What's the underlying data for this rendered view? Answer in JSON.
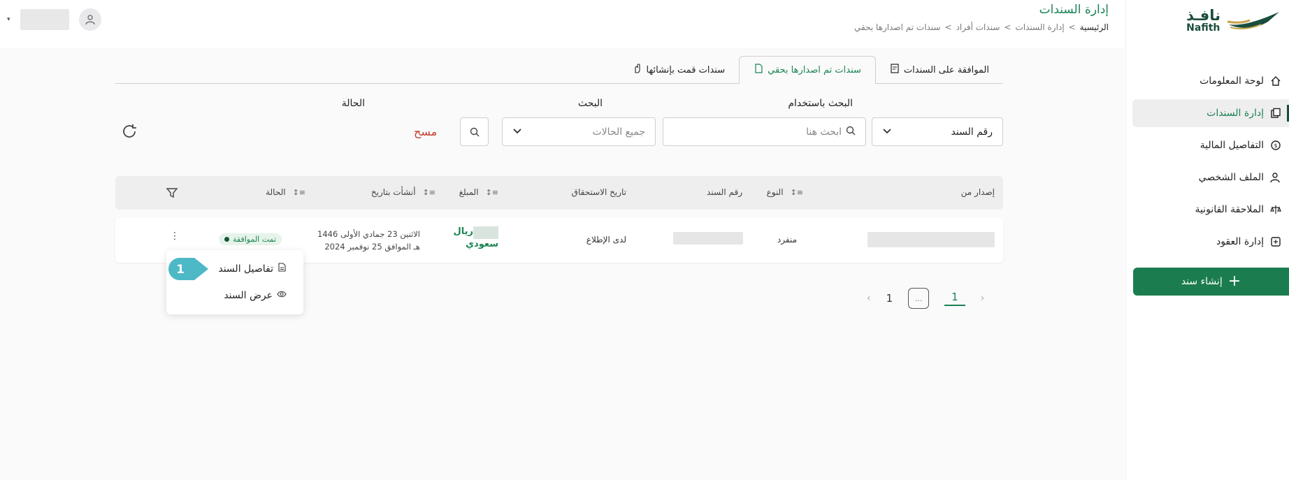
{
  "brand": {
    "name_ar": "نافـذ",
    "name_en": "Nafith"
  },
  "sidebar": {
    "items": [
      {
        "label": "لوحة المعلومات",
        "icon": "home-icon"
      },
      {
        "label": "إدارة السندات",
        "icon": "documents-icon",
        "active": true
      },
      {
        "label": "التفاصيل المالية",
        "icon": "money-icon"
      },
      {
        "label": "الملف الشخصي",
        "icon": "user-settings-icon"
      },
      {
        "label": "الملاحقة القانونية",
        "icon": "legal-icon"
      },
      {
        "label": "إدارة العقود",
        "icon": "contracts-icon"
      }
    ],
    "create_label": "إنشاء سند"
  },
  "header": {
    "title": "إدارة السندات",
    "breadcrumb": [
      "الرئيسية",
      ">",
      "إدارة السندات",
      ">",
      "سندات أفراد",
      ">",
      "سندات تم اصدارها بحقي"
    ]
  },
  "tabs": [
    {
      "label": "الموافقة على السندات",
      "icon": "approval-icon"
    },
    {
      "label": "سندات تم اصدارها بحقي",
      "icon": "document-icon",
      "active": true
    },
    {
      "label": "سندات قمت بإنشائها",
      "icon": "hand-icon"
    }
  ],
  "filters": {
    "search_by_label": "البحث باستخدام",
    "search_by_value": "رقم السند",
    "search_label": "البحث",
    "search_placeholder": "ابحث هنا",
    "status_label": "الحالة",
    "status_value": "جميع الحالات",
    "clear_label": "مسح"
  },
  "table": {
    "headers": {
      "issued_by": "إصدار من",
      "type": "النوع",
      "bond_number": "رقم السند",
      "due_date": "تاريخ الاستحقاق",
      "amount": "المبلغ",
      "created_at": "أنشأت بتاريخ",
      "status": "الحالة"
    },
    "rows": [
      {
        "type": "منفرد",
        "due_date": "لدى الإطلاع",
        "amount_currency_1": "ريال",
        "amount_currency_2": "سعودي",
        "created_line1": "الاثنين 23 جمادي الأولى 1446",
        "created_line2": "هـ الموافق 25 نوفمبر 2024",
        "status": "تمت الموافقة"
      }
    ]
  },
  "row_menu": {
    "items": [
      {
        "label": "تفاصيل السند",
        "icon": "file-icon"
      },
      {
        "label": "عرض السند",
        "icon": "eye-icon"
      }
    ],
    "step_badge": "1"
  },
  "pagination": {
    "pages": [
      "1",
      "...",
      "1"
    ]
  },
  "colors": {
    "primary": "#1b8354",
    "create_button": "#1b7d4f",
    "clear": "#c0392b"
  }
}
